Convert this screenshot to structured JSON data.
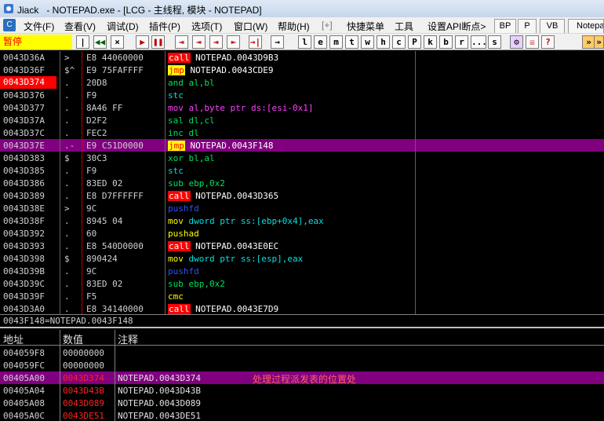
{
  "window": {
    "title": "Jiack   - NOTEPAD.exe - [LCG - 主线程, 模块 - NOTEPAD]"
  },
  "menu": {
    "items": [
      "文件(F)",
      "查看(V)",
      "调试(D)",
      "插件(P)",
      "选项(T)",
      "窗口(W)",
      "帮助(H)",
      "[+]",
      "快捷菜单",
      "工具",
      "设置API断点>"
    ],
    "right_buttons": [
      "BP",
      "P",
      "VB",
      "Notepa"
    ]
  },
  "toolbar": {
    "status": "暂停",
    "buttons": [
      "|◀◀",
      "◀◀",
      "×",
      "▶",
      "❚❚",
      "⇥",
      "⇥",
      "⇥",
      "⇤",
      "→|",
      "l",
      "e",
      "m",
      "t",
      "w",
      "h",
      "c",
      "P",
      "k",
      "b",
      "r",
      "...",
      "s"
    ]
  },
  "disasm": {
    "rows": [
      {
        "addr": "0043D36A",
        "mark": ">",
        "hex": "E8 44060000",
        "op": "call",
        "arg": " NOTEPAD.0043D9B3",
        "style": "call"
      },
      {
        "addr": "0043D36F",
        "mark": "$^",
        "hex": "E9 75FAFFFF",
        "op": "jmp",
        "arg": " NOTEPAD.0043CDE9",
        "style": "jmp"
      },
      {
        "addr": "0043D374",
        "mark": ".",
        "hex": "20D8",
        "op": "and",
        "arg": " al,bl",
        "style": "green",
        "bp": true
      },
      {
        "addr": "0043D376",
        "mark": ".",
        "hex": "F9",
        "op": "stc",
        "arg": "",
        "style": "cyan"
      },
      {
        "addr": "0043D377",
        "mark": ".",
        "hex": "8A46 FF",
        "op": "mov",
        "arg": " al,byte ptr ds:[esi-0x1]",
        "style": "mov1"
      },
      {
        "addr": "0043D37A",
        "mark": ".",
        "hex": "D2F2",
        "op": "sal",
        "arg": " dl,cl",
        "style": "green"
      },
      {
        "addr": "0043D37C",
        "mark": ".",
        "hex": "FEC2",
        "op": "inc",
        "arg": " dl",
        "style": "green"
      },
      {
        "addr": "0043D37E",
        "mark": ".-",
        "hex": "E9 C51D0000",
        "op": "jmp",
        "arg": " NOTEPAD.0043F148",
        "style": "jmp",
        "sel": true
      },
      {
        "addr": "0043D383",
        "mark": "$",
        "hex": "30C3",
        "op": "xor",
        "arg": " bl,al",
        "style": "green"
      },
      {
        "addr": "0043D385",
        "mark": ".",
        "hex": "F9",
        "op": "stc",
        "arg": "",
        "style": "cyan"
      },
      {
        "addr": "0043D386",
        "mark": ".",
        "hex": "83ED 02",
        "op": "sub",
        "arg": " ebp,0x2",
        "style": "sub"
      },
      {
        "addr": "0043D389",
        "mark": ".",
        "hex": "E8 D7FFFFFF",
        "op": "call",
        "arg": " NOTEPAD.0043D365",
        "style": "call"
      },
      {
        "addr": "0043D38E",
        "mark": ">",
        "hex": "9C",
        "op": "pushfd",
        "arg": "",
        "style": "blue"
      },
      {
        "addr": "0043D38F",
        "mark": ".",
        "hex": "8945 04",
        "op": "mov",
        "arg": " dword ptr ss:[ebp+0x4],eax",
        "style": "mov2"
      },
      {
        "addr": "0043D392",
        "mark": ".",
        "hex": "60",
        "op": "pushad",
        "arg": "",
        "style": "yellow"
      },
      {
        "addr": "0043D393",
        "mark": ".",
        "hex": "E8 540D0000",
        "op": "call",
        "arg": " NOTEPAD.0043E0EC",
        "style": "call"
      },
      {
        "addr": "0043D398",
        "mark": "$",
        "hex": "890424",
        "op": "mov",
        "arg": " dword ptr ss:[esp],eax",
        "style": "mov2"
      },
      {
        "addr": "0043D39B",
        "mark": ".",
        "hex": "9C",
        "op": "pushfd",
        "arg": "",
        "style": "blue"
      },
      {
        "addr": "0043D39C",
        "mark": ".",
        "hex": "83ED 02",
        "op": "sub",
        "arg": " ebp,0x2",
        "style": "sub"
      },
      {
        "addr": "0043D39F",
        "mark": ".",
        "hex": "F5",
        "op": "cmc",
        "arg": "",
        "style": "yellow"
      },
      {
        "addr": "0043D3A0",
        "mark": ".",
        "hex": "E8 34140000",
        "op": "call",
        "arg": " NOTEPAD.0043E7D9",
        "style": "call"
      }
    ]
  },
  "info": {
    "text": "0043F148=NOTEPAD.0043F148"
  },
  "stack": {
    "headers": [
      "地址",
      "数值",
      "注释"
    ],
    "rows": [
      {
        "addr": "004059F8",
        "val": "00000000",
        "cmt": "",
        "note": "",
        "red": false
      },
      {
        "addr": "004059FC",
        "val": "00000000",
        "cmt": "",
        "note": "",
        "red": false
      },
      {
        "addr": "00405A00",
        "val": "0043D374",
        "cmt": "NOTEPAD.0043D374",
        "note": "处理过程派发表的位置处",
        "red": true,
        "sel": true
      },
      {
        "addr": "00405A04",
        "val": "0043D43B",
        "cmt": "NOTEPAD.0043D43B",
        "note": "",
        "red": true
      },
      {
        "addr": "00405A08",
        "val": "0043D089",
        "cmt": "NOTEPAD.0043D089",
        "note": "",
        "red": true
      },
      {
        "addr": "00405A0C",
        "val": "0043DE51",
        "cmt": "NOTEPAD.0043DE51",
        "note": "",
        "red": true
      }
    ]
  }
}
